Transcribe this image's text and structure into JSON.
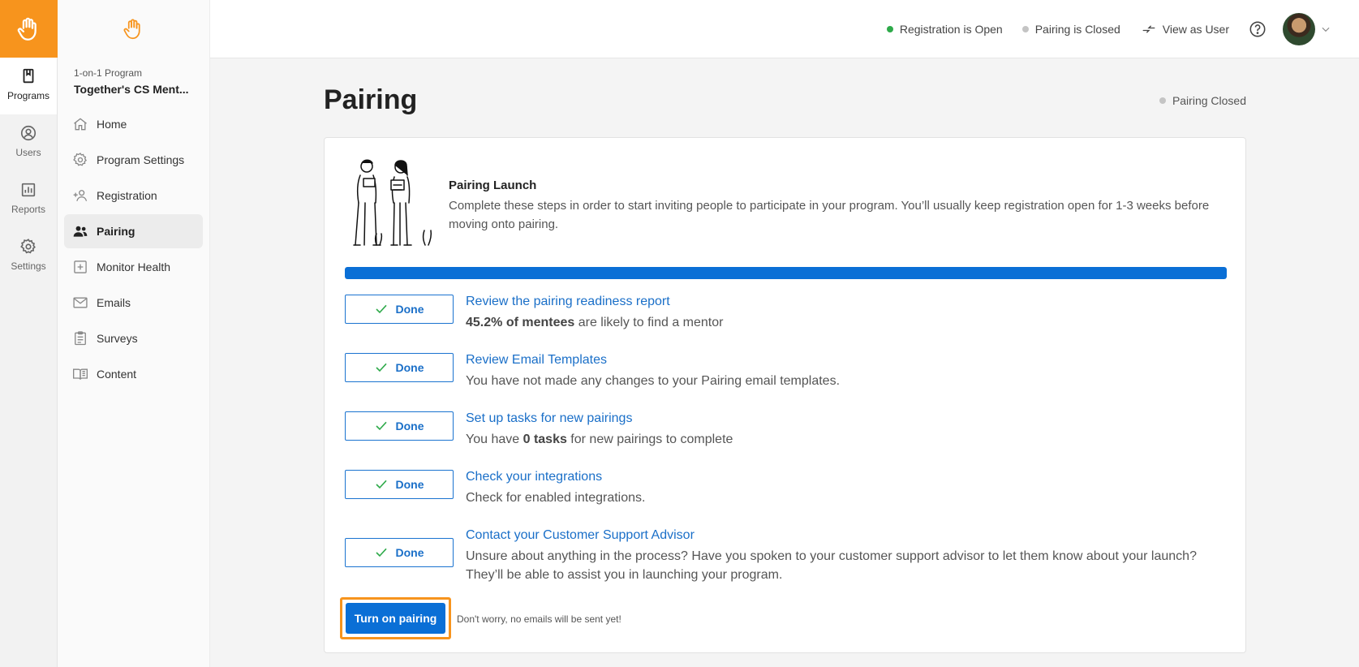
{
  "rail": {
    "items": [
      {
        "label": "Programs",
        "icon": "book-icon",
        "active": true
      },
      {
        "label": "Users",
        "icon": "user-circle-icon",
        "active": false
      },
      {
        "label": "Reports",
        "icon": "bar-chart-icon",
        "active": false
      },
      {
        "label": "Settings",
        "icon": "gear-icon",
        "active": false
      }
    ]
  },
  "sidebar": {
    "program_type": "1-on-1 Program",
    "program_name": "Together's CS Ment...",
    "items": [
      {
        "label": "Home",
        "icon": "home-icon"
      },
      {
        "label": "Program Settings",
        "icon": "gear-icon"
      },
      {
        "label": "Registration",
        "icon": "person-add-icon"
      },
      {
        "label": "Pairing",
        "icon": "people-icon",
        "active": true
      },
      {
        "label": "Monitor Health",
        "icon": "plus-square-icon"
      },
      {
        "label": "Emails",
        "icon": "envelope-icon"
      },
      {
        "label": "Surveys",
        "icon": "clipboard-icon"
      },
      {
        "label": "Content",
        "icon": "open-book-icon"
      }
    ]
  },
  "topbar": {
    "registration_status": "Registration is Open",
    "pairing_status": "Pairing is Closed",
    "view_as_user": "View as User",
    "colors": {
      "open": "#2eaa4a",
      "closed": "#c4c4c4"
    }
  },
  "main": {
    "title": "Pairing",
    "status": "Pairing Closed",
    "launch": {
      "title": "Pairing Launch",
      "description": "Complete these steps in order to start inviting people to participate in your program. You’ll usually keep registration open for 1-3 weeks before moving onto pairing.",
      "progress": 1.0
    },
    "done_label": "Done",
    "steps": [
      {
        "link": "Review the pairing readiness report",
        "desc_bold": "45.2% of mentees",
        "desc_rest": " are likely to find a mentor"
      },
      {
        "link": "Review Email Templates",
        "desc": "You have not made any changes to your Pairing email templates."
      },
      {
        "link": "Set up tasks for new pairings",
        "desc_pre": "You have ",
        "desc_bold": "0 tasks",
        "desc_rest": " for new pairings to complete"
      },
      {
        "link": "Check your integrations",
        "desc": "Check for enabled integrations."
      },
      {
        "link": "Contact your Customer Support Advisor",
        "desc": "Unsure about anything in the process? Have you spoken to your customer support advisor to let them know about your launch? They’ll be able to assist you in launching your program."
      }
    ],
    "turn_on_label": "Turn on pairing",
    "turn_on_note": "Don't worry, no emails will be sent yet!",
    "accent": "#0a6fd6",
    "highlight": "#f7941d"
  }
}
